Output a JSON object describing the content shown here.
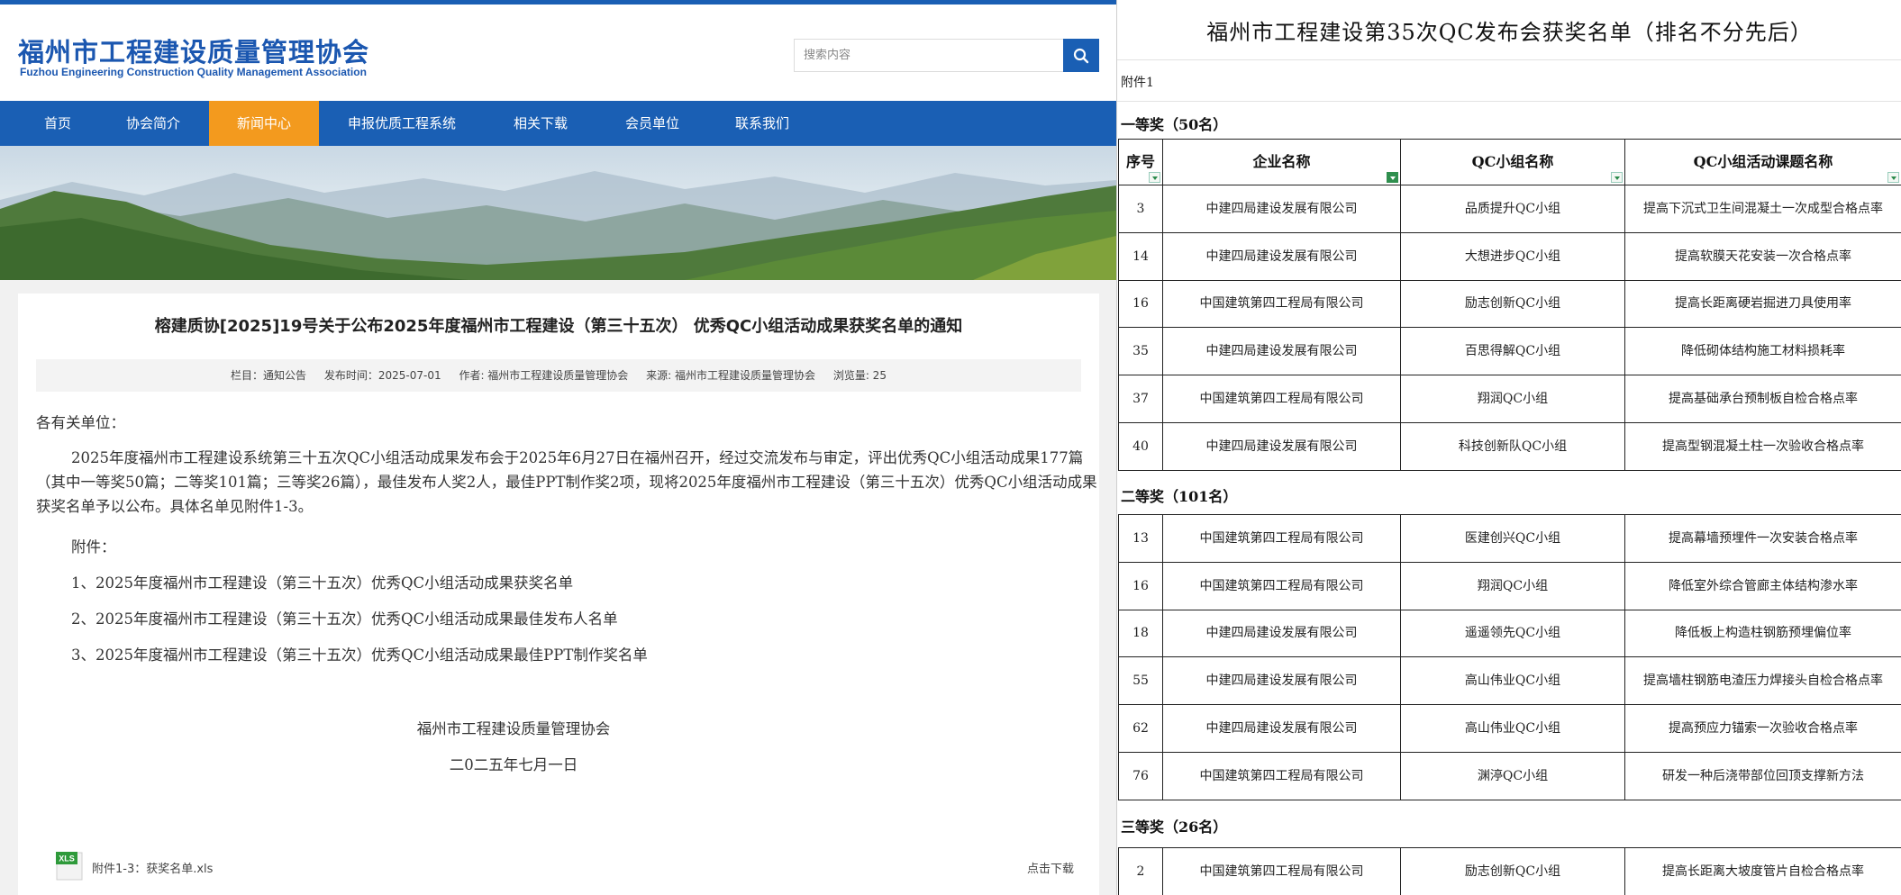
{
  "site": {
    "logo_cn": "福州市工程建设质量管理协会",
    "logo_en": "Fuzhou Engineering Construction Quality Management Association",
    "search_placeholder": "搜索内容",
    "brand_color": "#1a5fb4",
    "active_nav_color": "#f39a1e"
  },
  "nav": [
    {
      "label": "首页",
      "active": false
    },
    {
      "label": "协会简介",
      "active": false
    },
    {
      "label": "新闻中心",
      "active": true
    },
    {
      "label": "申报优质工程系统",
      "active": false
    },
    {
      "label": "相关下载",
      "active": false
    },
    {
      "label": "会员单位",
      "active": false
    },
    {
      "label": "联系我们",
      "active": false
    }
  ],
  "article": {
    "title": "榕建质协[2025]19号关于公布2025年度福州市工程建设（第三十五次） 优秀QC小组活动成果获奖名单的通知",
    "meta": {
      "column": "栏目：通知公告",
      "date": "发布时间：2025-07-01",
      "author": "作者: 福州市工程建设质量管理协会",
      "source": "来源: 福州市工程建设质量管理协会",
      "views": "浏览量: 25"
    },
    "salutation": "各有关单位：",
    "paragraph": "2025年度福州市工程建设系统第三十五次QC小组活动成果发布会于2025年6月27日在福州召开，经过交流发布与审定，评出优秀QC小组活动成果177篇（其中一等奖50篇；二等奖101篇；三等奖26篇），最佳发布人奖2人，最佳PPT制作奖2项，现将2025年度福州市工程建设（第三十五次）优秀QC小组活动成果获奖名单予以公布。具体名单见附件1-3。",
    "attachments_label": "附件：",
    "attachments": [
      "1、2025年度福州市工程建设（第三十五次）优秀QC小组活动成果获奖名单",
      "2、2025年度福州市工程建设（第三十五次）优秀QC小组活动成果最佳发布人名单",
      "3、2025年度福州市工程建设（第三十五次）优秀QC小组活动成果最佳PPT制作奖名单"
    ],
    "sign_org": "福州市工程建设质量管理协会",
    "sign_date": "二0二五年七月一日",
    "file_icon": "XLS",
    "file_name": "附件1-3：获奖名单.xls",
    "download_label": "点击下载"
  },
  "sheet": {
    "title": "福州市工程建设第35次QC发布会获奖名单（排名不分先后）",
    "attachment_no": "附件1",
    "headers": [
      "序号",
      "企业名称",
      "QC小组名称",
      "QC小组活动课题名称"
    ],
    "sections": [
      {
        "label": "一等奖（50名）",
        "rows": [
          [
            "3",
            "中建四局建设发展有限公司",
            "品质提升QC小组",
            "提高下沉式卫生间混凝土一次成型合格点率"
          ],
          [
            "14",
            "中建四局建设发展有限公司",
            "大想进步QC小组",
            "提高软膜天花安装一次合格点率"
          ],
          [
            "16",
            "中国建筑第四工程局有限公司",
            "励志创新QC小组",
            "提高长距离硬岩掘进刀具使用率"
          ],
          [
            "35",
            "中建四局建设发展有限公司",
            "百思得解QC小组",
            "降低砌体结构施工材料损耗率"
          ],
          [
            "37",
            "中国建筑第四工程局有限公司",
            "翔润QC小组",
            "提高基础承台预制板自检合格点率"
          ],
          [
            "40",
            "中建四局建设发展有限公司",
            "科技创新队QC小组",
            "提高型钢混凝土柱一次验收合格点率"
          ]
        ]
      },
      {
        "label": "二等奖（101名）",
        "rows": [
          [
            "13",
            "中国建筑第四工程局有限公司",
            "医建创兴QC小组",
            "提高幕墙预埋件一次安装合格点率"
          ],
          [
            "16",
            "中国建筑第四工程局有限公司",
            "翔润QC小组",
            "降低室外综合管廊主体结构渗水率"
          ],
          [
            "18",
            "中建四局建设发展有限公司",
            "遥遥领先QC小组",
            "降低板上构造柱钢筋预埋偏位率"
          ],
          [
            "55",
            "中建四局建设发展有限公司",
            "高山伟业QC小组",
            "提高墙柱钢筋电渣压力焊接头自检合格点率"
          ],
          [
            "62",
            "中建四局建设发展有限公司",
            "高山伟业QC小组",
            "提高预应力锚索一次验收合格点率"
          ],
          [
            "76",
            "中国建筑第四工程局有限公司",
            "渊渟QC小组",
            "研发一种后浇带部位回顶支撑新方法"
          ]
        ]
      },
      {
        "label": "三等奖（26名）",
        "rows": [
          [
            "2",
            "中国建筑第四工程局有限公司",
            "励志创新QC小组",
            "提高长距离大坡度管片自检合格点率"
          ]
        ]
      }
    ]
  }
}
